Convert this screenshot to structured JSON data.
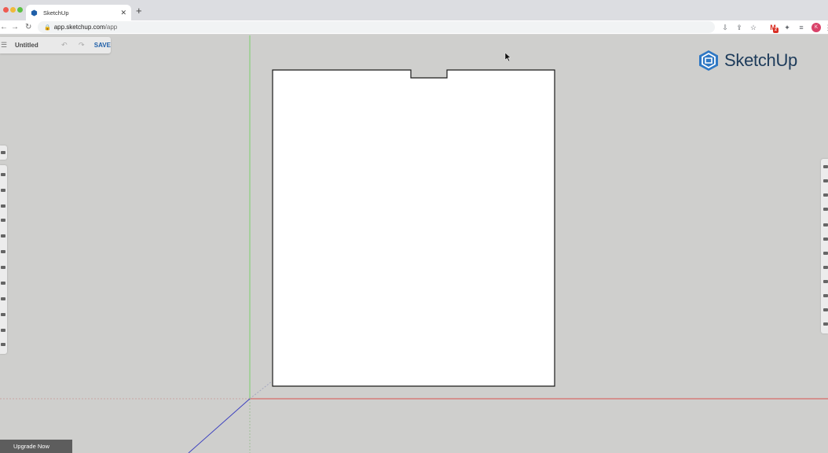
{
  "browser": {
    "tab": {
      "title": "SketchUp"
    },
    "address": {
      "host": "app.sketchup.com",
      "path": "/app"
    },
    "profile_initial": "K",
    "extension_badge": "2"
  },
  "app": {
    "document_title": "Untitled",
    "save_label": "SAVE",
    "logo_text": "SketchUp",
    "upgrade_label": "Upgrade Now"
  },
  "colors": {
    "canvas_bg": "#cfcfcd",
    "sketchup_blue": "#1f5fa8",
    "axis_green": "#7bcf6a",
    "axis_red": "#d9534f",
    "axis_blue": "#3b3fbf"
  }
}
